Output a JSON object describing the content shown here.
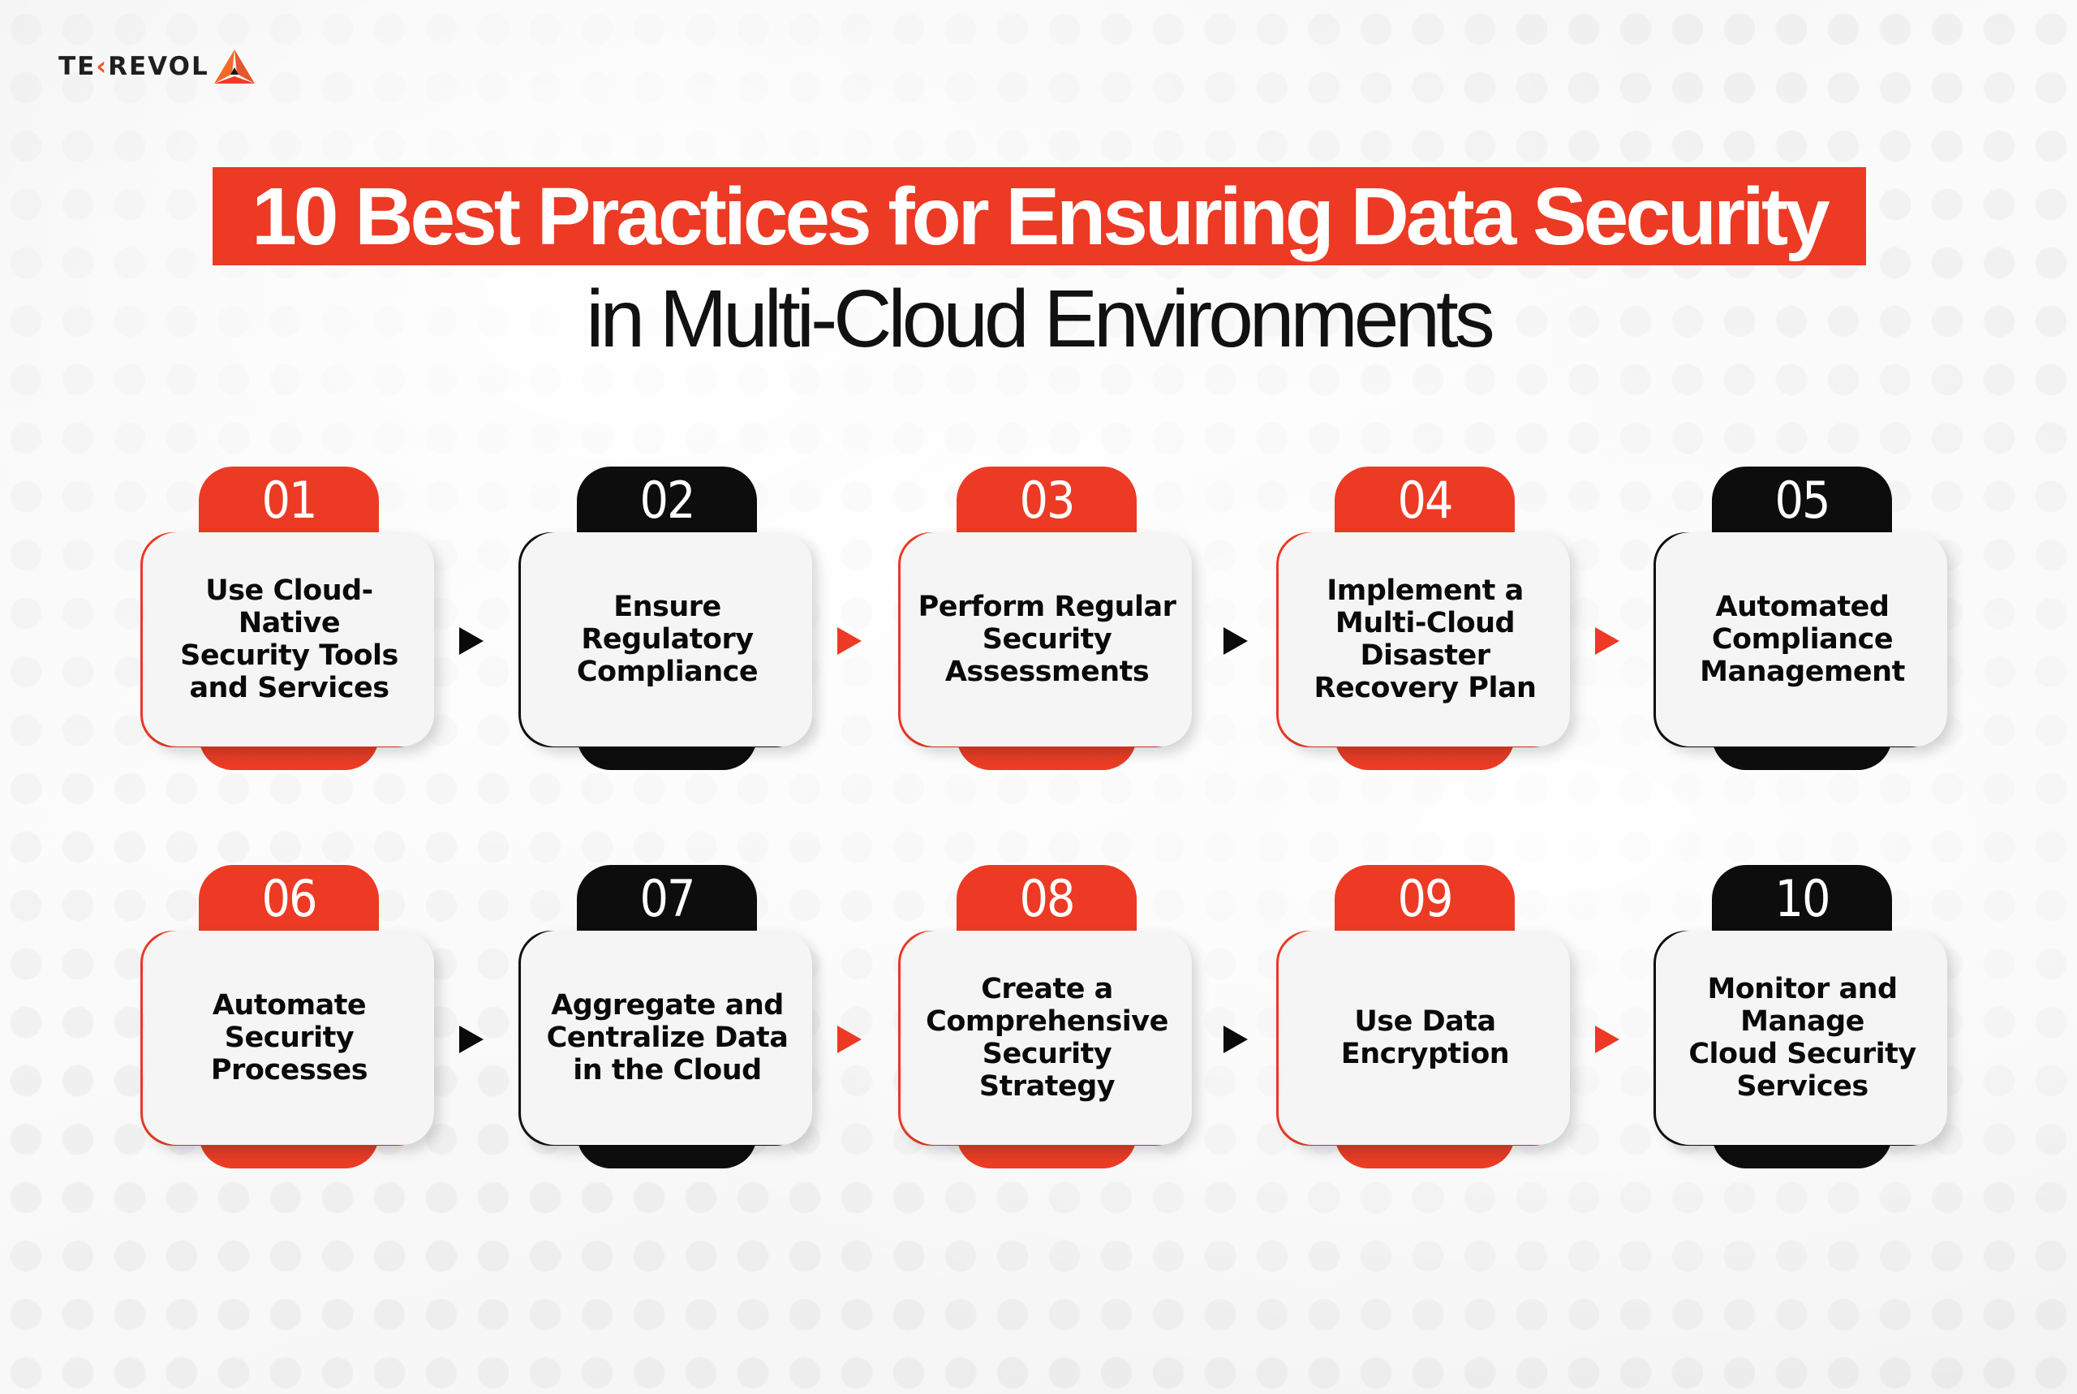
{
  "brand": {
    "logo_prefix": "TE",
    "logo_accent": "‹",
    "logo_suffix": "REVOL",
    "logo_icon": "triangle-logo-icon"
  },
  "colors": {
    "accent_red": "#ec3a24",
    "dark": "#0d0d0d",
    "card_bg": "#f5f5f5",
    "logo_orange": "#f0531f"
  },
  "title": {
    "headline": "10 Best Practices for Ensuring Data Security",
    "subtitle": "in Multi-Cloud Environments"
  },
  "steps": [
    {
      "number": "01",
      "label": "Use Cloud-Native\nSecurity Tools\nand Services",
      "color": "red"
    },
    {
      "number": "02",
      "label": "Ensure\nRegulatory\nCompliance",
      "color": "black"
    },
    {
      "number": "03",
      "label": "Perform Regular\nSecurity\nAssessments",
      "color": "red"
    },
    {
      "number": "04",
      "label": "Implement a\nMulti-Cloud\nDisaster\nRecovery Plan",
      "color": "red"
    },
    {
      "number": "05",
      "label": "Automated\nCompliance\nManagement",
      "color": "black"
    },
    {
      "number": "06",
      "label": "Automate\nSecurity\nProcesses",
      "color": "red"
    },
    {
      "number": "07",
      "label": "Aggregate and\nCentralize Data\nin the Cloud",
      "color": "black"
    },
    {
      "number": "08",
      "label": "Create a\nComprehensive\nSecurity Strategy",
      "color": "red"
    },
    {
      "number": "09",
      "label": "Use Data\nEncryption",
      "color": "red"
    },
    {
      "number": "10",
      "label": "Monitor and\nManage\nCloud Security\nServices",
      "color": "black"
    }
  ],
  "arrows": [
    {
      "from": "01",
      "to": "02",
      "icon": "arrow-right-icon",
      "color": "black"
    },
    {
      "from": "02",
      "to": "03",
      "icon": "arrow-right-icon",
      "color": "red"
    },
    {
      "from": "03",
      "to": "04",
      "icon": "arrow-right-icon",
      "color": "black"
    },
    {
      "from": "04",
      "to": "05",
      "icon": "arrow-right-icon",
      "color": "red"
    },
    {
      "from": "06",
      "to": "07",
      "icon": "arrow-right-icon",
      "color": "black"
    },
    {
      "from": "07",
      "to": "08",
      "icon": "arrow-right-icon",
      "color": "red"
    },
    {
      "from": "08",
      "to": "09",
      "icon": "arrow-right-icon",
      "color": "black"
    },
    {
      "from": "09",
      "to": "10",
      "icon": "arrow-right-icon",
      "color": "red"
    }
  ]
}
